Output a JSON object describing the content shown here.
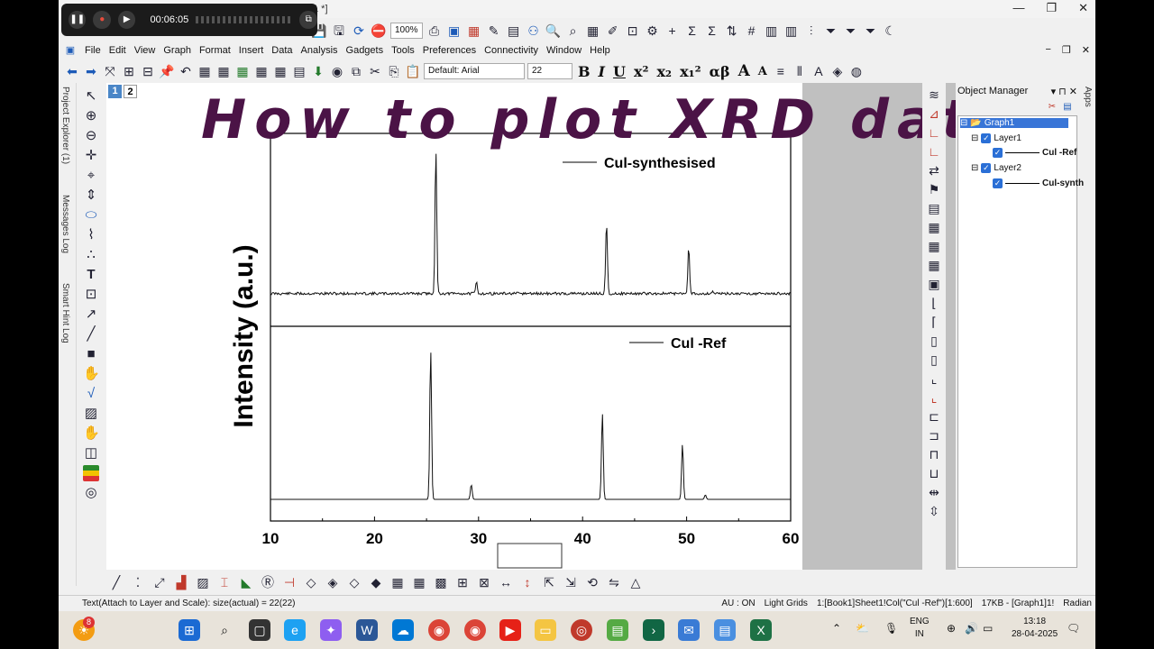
{
  "window": {
    "title_fragment": "1 *]",
    "minimize": "—",
    "restore": "❐",
    "close": "✕"
  },
  "recorder": {
    "time": "00:06:05"
  },
  "toolbar1": {
    "zoom": "100%"
  },
  "menu": {
    "items": [
      "File",
      "Edit",
      "View",
      "Graph",
      "Format",
      "Insert",
      "Data",
      "Analysis",
      "Gadgets",
      "Tools",
      "Preferences",
      "Connectivity",
      "Window",
      "Help"
    ]
  },
  "toolbar2": {
    "font": "Default: Arial",
    "font_size": "22",
    "bold": "B",
    "italic": "I",
    "underline": "U",
    "superscript": "x²",
    "subscript": "x₂",
    "supsub": "x₁²",
    "greek": "αβ",
    "grow": "A",
    "shrink": "A"
  },
  "left_dock": {
    "project_explorer": "Project Explorer (1)",
    "messages_log": "Messages Log",
    "smart_hint_log": "Smart Hint Log"
  },
  "layer_tabs": [
    "1",
    "2"
  ],
  "overlay_title": "How to plot XRD data",
  "chart_data": {
    "type": "line",
    "ylabel": "Intensity (a.u.)",
    "xlim": [
      10,
      60
    ],
    "x_ticks": [
      "10",
      "20",
      "30",
      "40",
      "50",
      "60"
    ],
    "series": [
      {
        "name": "CuI-synthesised",
        "legend_label": "Cul-synthesised",
        "layer": 2,
        "baseline": 0.05,
        "x": [
          10,
          25.9,
          29.8,
          42.3,
          50.2,
          52.5,
          60
        ],
        "peaks": [
          {
            "x": 25.9,
            "height": 1.0
          },
          {
            "x": 29.8,
            "height": 0.08
          },
          {
            "x": 42.3,
            "height": 0.5
          },
          {
            "x": 50.2,
            "height": 0.32
          },
          {
            "x": 52.5,
            "height": 0.02
          }
        ]
      },
      {
        "name": "CuI-Ref",
        "legend_label": "Cul -Ref",
        "layer": 1,
        "baseline": 0.0,
        "x": [
          10,
          25.4,
          29.3,
          41.9,
          49.6,
          51.8,
          60
        ],
        "peaks": [
          {
            "x": 25.4,
            "height": 1.0
          },
          {
            "x": 29.3,
            "height": 0.1
          },
          {
            "x": 41.9,
            "height": 0.58
          },
          {
            "x": 49.6,
            "height": 0.37
          },
          {
            "x": 51.8,
            "height": 0.03
          }
        ]
      }
    ]
  },
  "object_manager": {
    "title": "Object Manager",
    "graph": "Graph1",
    "layer1": "Layer1",
    "layer1_plot": "Cul -Ref",
    "layer2": "Layer2",
    "layer2_plot": "Cul-synth",
    "apps_tab": "Apps"
  },
  "status": {
    "left": "Text(Attach to Layer and Scale): size(actual) = 22(22)",
    "au": "AU : ON",
    "grids": "Light Grids",
    "cell": "1:[Book1]Sheet1!Col(\"Cul -Ref\")[1:600]",
    "size": "17KB - [Graph1]1!",
    "angle": "Radian"
  },
  "taskbar": {
    "badge": "8",
    "lang1": "ENG",
    "lang2": "IN",
    "time": "13:18",
    "date": "28-04-2025"
  }
}
